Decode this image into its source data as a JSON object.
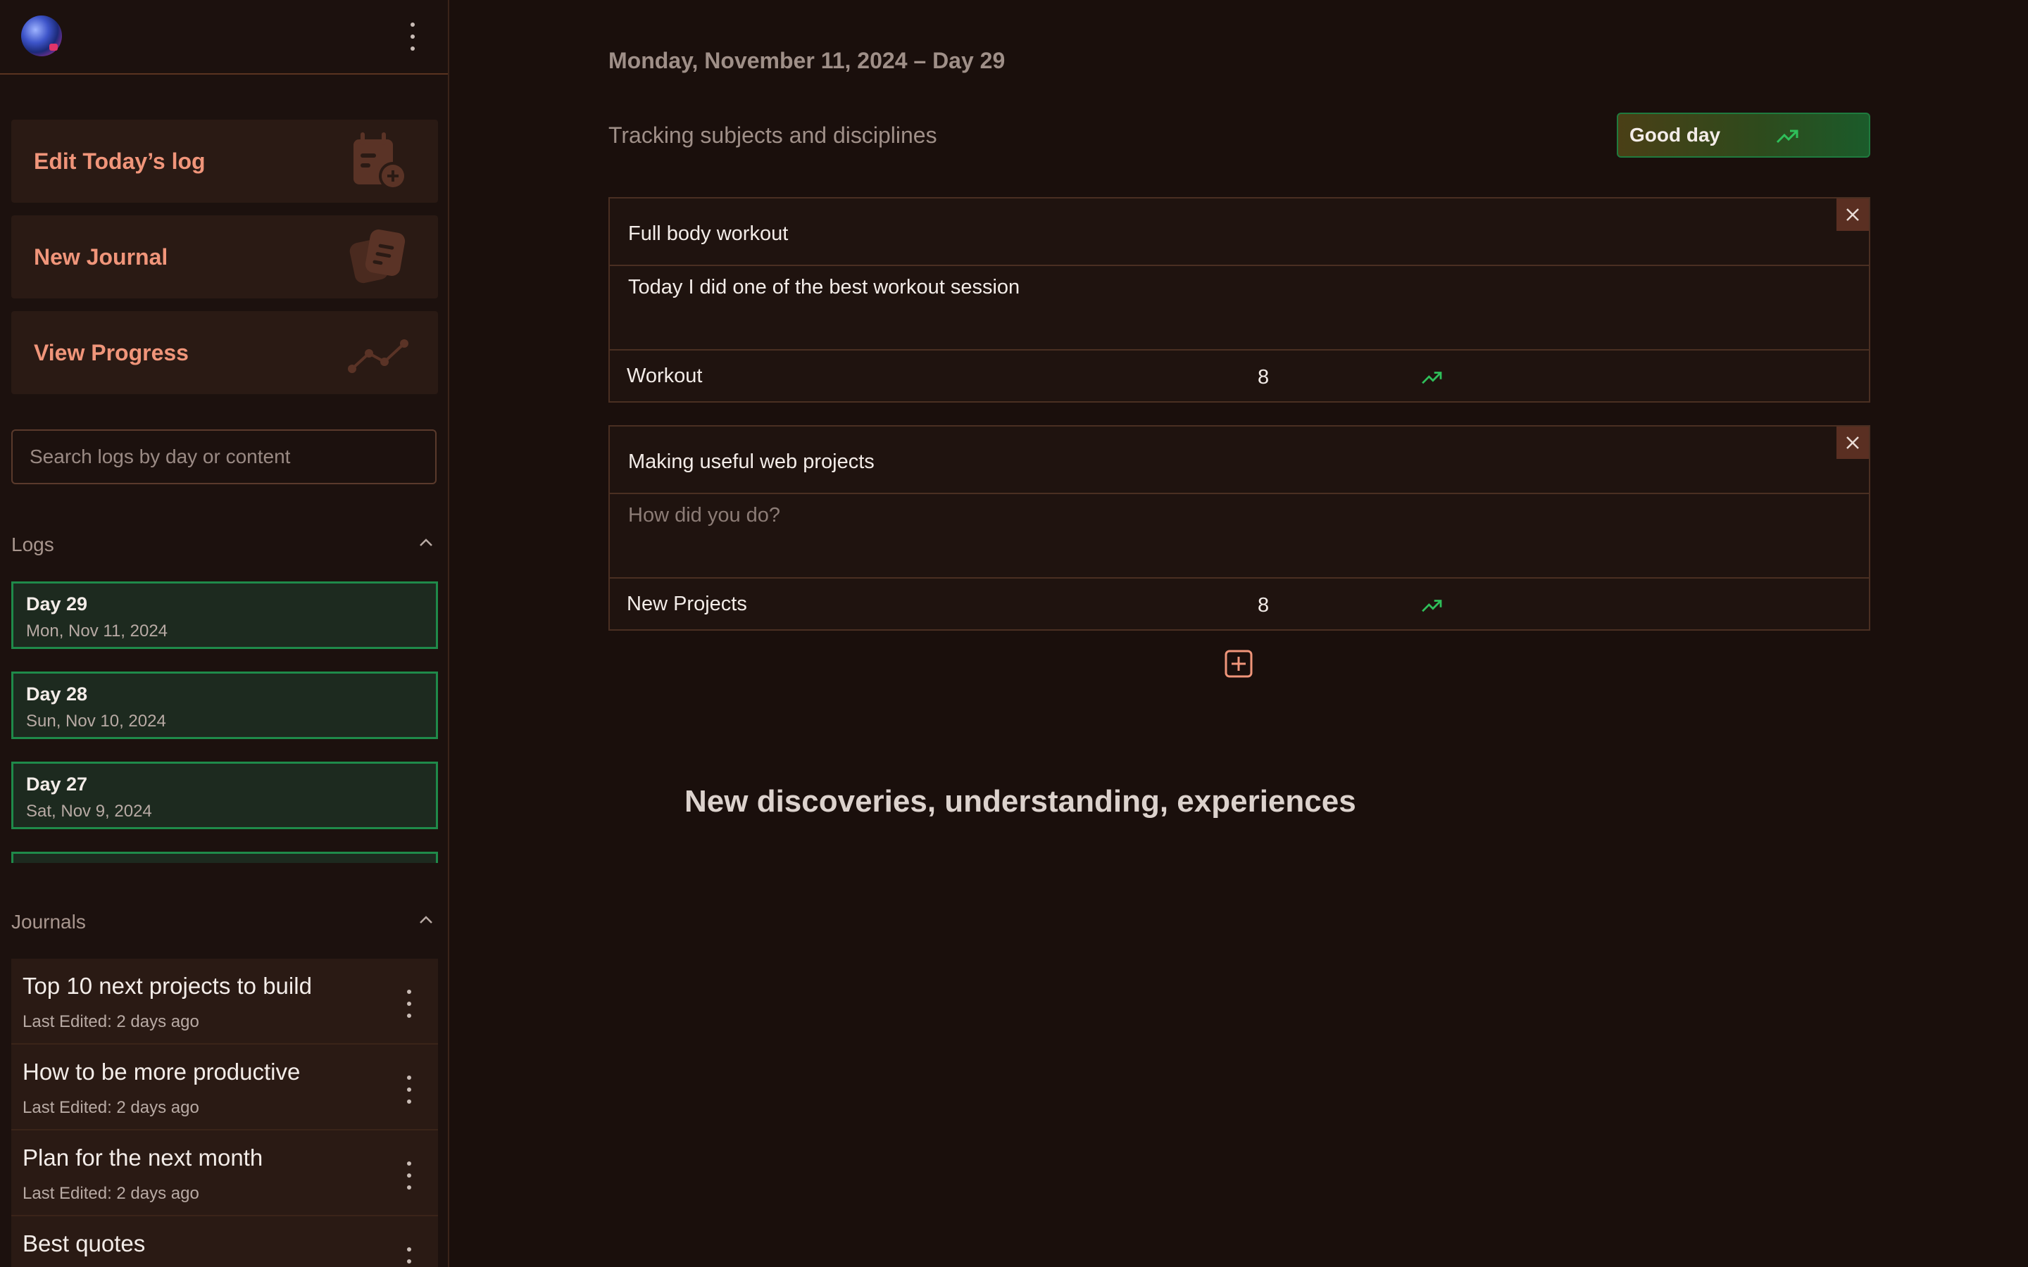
{
  "sidebar": {
    "actions": [
      {
        "label": "Edit Today’s log",
        "icon": "calendar-add-icon"
      },
      {
        "label": "New Journal",
        "icon": "journal-icon"
      },
      {
        "label": "View Progress",
        "icon": "progress-chart-icon"
      }
    ],
    "search": {
      "placeholder": "Search logs by day or content"
    },
    "logs": {
      "title": "Logs",
      "items": [
        {
          "day": "Day 29",
          "date": "Mon, Nov 11, 2024"
        },
        {
          "day": "Day 28",
          "date": "Sun, Nov 10, 2024"
        },
        {
          "day": "Day 27",
          "date": "Sat, Nov 9, 2024"
        }
      ]
    },
    "journals": {
      "title": "Journals",
      "items": [
        {
          "title": "Top 10 next projects to build",
          "edited": "Last Edited: 2 days ago"
        },
        {
          "title": "How to be more productive",
          "edited": "Last Edited: 2 days ago"
        },
        {
          "title": "Plan for the next month",
          "edited": "Last Edited: 2 days ago"
        },
        {
          "title": "Best quotes",
          "edited": ""
        }
      ]
    }
  },
  "main": {
    "date_line": "Monday, November 11, 2024 – Day 29",
    "subtitle": "Tracking subjects and disciplines",
    "mood": {
      "label": "Good day",
      "trend": "up"
    },
    "entries": [
      {
        "title": "Full body workout",
        "body": "Today I did one of the best workout session",
        "body_placeholder": "",
        "metric": "Workout",
        "score": "8",
        "trend": "up"
      },
      {
        "title": "Making useful web projects",
        "body": "",
        "body_placeholder": "How did you do?",
        "metric": "New Projects",
        "score": "8",
        "trend": "up"
      }
    ],
    "discoveries_title": "New discoveries, understanding, experiences"
  },
  "colors": {
    "background": "#1a0f0c",
    "accent": "#f0957a",
    "positive": "#2fbf5a",
    "log_border": "#1f8a4a"
  }
}
